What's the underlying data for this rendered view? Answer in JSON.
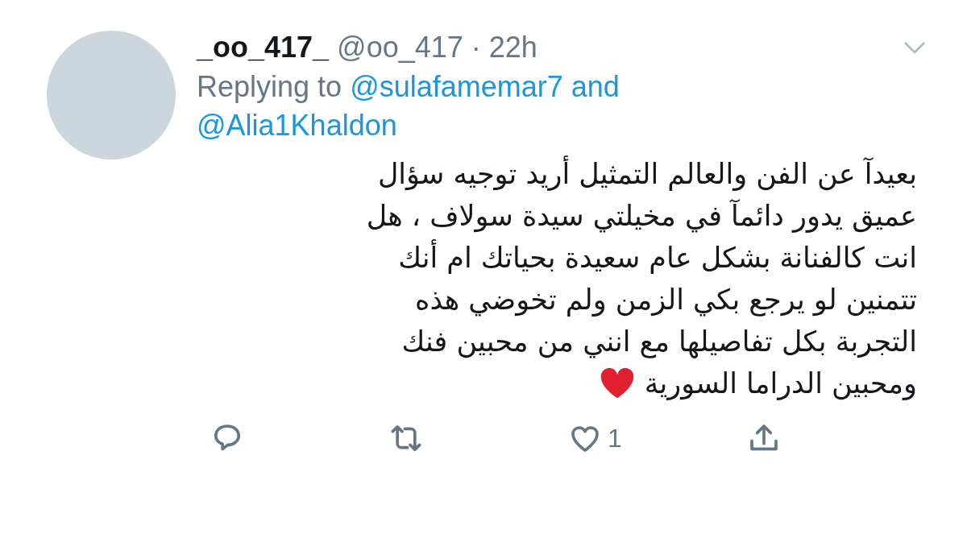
{
  "tweet": {
    "display_name": "_oo_417_",
    "handle": "@oo_417",
    "separator": "·",
    "time": "22h",
    "reply_prefix": "Replying to",
    "reply_mentions": [
      "@sulafamemar7",
      "@Alia1Khaldon"
    ],
    "reply_conjunction": "and",
    "text_lines": [
      "بعيدآ عن الفن والعالم التمثيل أريد توجيه سؤال",
      "عميق يدور دائمآ في مخيلتي سيدة سولاف ، هل",
      "انت كالفنانة بشكل عام سعيدة بحياتك ام أنك",
      "تتمنين لو يرجع بكي الزمن ولم تخوضي هذه",
      "التجربة بكل تفاصيلها مع انني من محبين فنك",
      "ومحبين الدراما السورية"
    ],
    "actions": [
      {
        "kind": "reply"
      },
      {
        "kind": "retweet"
      },
      {
        "kind": "like",
        "count": "1"
      },
      {
        "kind": "share"
      }
    ]
  }
}
